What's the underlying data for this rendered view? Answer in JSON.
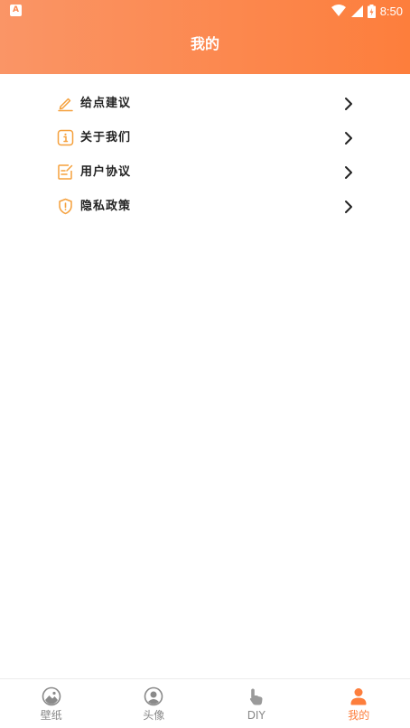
{
  "status_bar": {
    "time": "8:50",
    "left_icon_letter": "A"
  },
  "header": {
    "title": "我的"
  },
  "menu": {
    "items": [
      {
        "label": "给点建议",
        "icon": "pencil-icon"
      },
      {
        "label": "关于我们",
        "icon": "info-icon"
      },
      {
        "label": "用户协议",
        "icon": "agreement-icon"
      },
      {
        "label": "隐私政策",
        "icon": "shield-icon"
      }
    ]
  },
  "tabbar": {
    "tabs": [
      {
        "label": "壁纸",
        "icon": "wallpaper-icon",
        "active": false
      },
      {
        "label": "头像",
        "icon": "avatar-icon",
        "active": false
      },
      {
        "label": "DIY",
        "icon": "hand-pointer-icon",
        "active": false
      },
      {
        "label": "我的",
        "icon": "person-icon",
        "active": true
      }
    ]
  },
  "colors": {
    "accent": "#fd7e3c",
    "header_gradient_start": "#fa9566",
    "icon_orange": "#f5a03c",
    "tab_inactive": "#888888"
  }
}
